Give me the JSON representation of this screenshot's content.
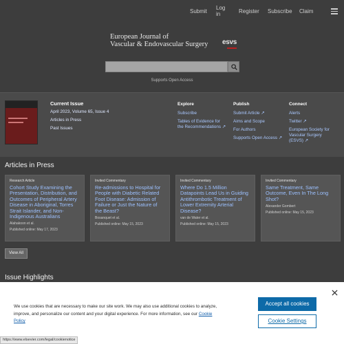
{
  "nav": {
    "items": [
      "Submit",
      "Log in",
      "Register",
      "Subscribe",
      "Claim"
    ]
  },
  "logo": {
    "line1": "European Journal of",
    "line2": "Vascular & Endovascular Surgery",
    "mark": "esvs"
  },
  "search": {
    "placeholder": ""
  },
  "supports_open_access": "Supports Open Access",
  "current_issue": {
    "heading": "Current Issue",
    "issue": "April 2023, Volume 65, Issue 4",
    "links": [
      "Articles in Press",
      "Past Issues"
    ]
  },
  "explore": {
    "heading": "Explore",
    "links": [
      "Subscribe",
      "Tables of Evidence for the Recommendations ↗"
    ]
  },
  "publish": {
    "heading": "Publish",
    "links": [
      "Submit Article ↗",
      "Aims and Scope",
      "For Authors",
      "Supports Open Access ↗"
    ]
  },
  "connect": {
    "heading": "Connect",
    "links": [
      "Alerts",
      "Twitter ↗",
      "European Society for Vascular Surgery (ESVS) ↗"
    ]
  },
  "articles_in_press": {
    "heading": "Articles in Press",
    "cards": [
      {
        "type": "Research Article",
        "title": "Cohort Study Examining the Presentation, Distribution, and Outcomes of Peripheral Artery Disease in Aboriginal, Torres Strait Islander, and Non-Indigenous Australians",
        "author": "Alahakoon et al.",
        "date": "Published online: May 17, 2023"
      },
      {
        "type": "Invited Commentary",
        "title": "Re-admissions to Hospital for People with Diabetic Related Foot Disease: Admission of Failure or Just the Nature of the Beast?",
        "author": "Bosanquet et al.",
        "date": "Published online: May 15, 2023"
      },
      {
        "type": "Invited Commentary",
        "title": "Where Do 1.5 Million Datapoints Lead Us in Guiding Antithrombotic Treatment of Lower Extremity Arterial Disease?",
        "author": "van de Water et al.",
        "date": "Published online: May 15, 2023"
      },
      {
        "type": "Invited Commentary",
        "title": "Same Treatment, Same Outcome, Even In The Long Shot?",
        "author": "Alexander Gombert",
        "date": "Published online: May 15, 2023"
      }
    ],
    "view_all": "View All"
  },
  "issue_highlights": "Issue Highlights",
  "cookie": {
    "text": "We use cookies that are necessary to make our site work. We may also use additional cookies to analyze, improve, and personalize our content and your digital experience. For more information, see our",
    "policy_link": "Cookie Policy",
    "accept": "Accept all cookies",
    "settings": "Cookie Settings"
  },
  "status_url": "https://www.elsevier.com/legal/cookienotice",
  "colors": {
    "background": "#3d3d3d",
    "link": "#9cc0ff",
    "accept_button": "#0d6aa8"
  }
}
